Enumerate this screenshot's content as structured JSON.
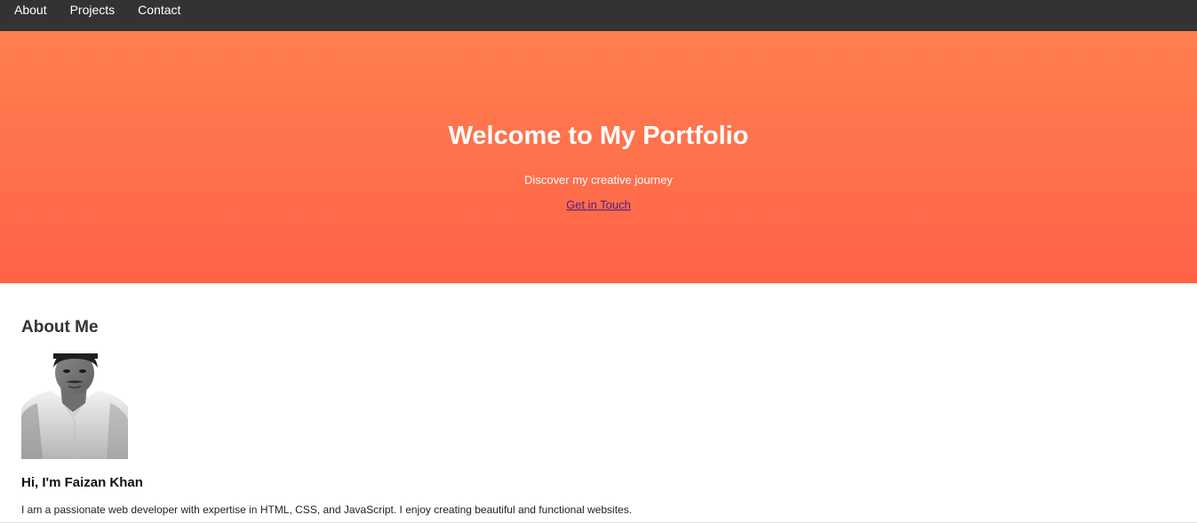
{
  "nav": {
    "items": [
      {
        "label": "About"
      },
      {
        "label": "Projects"
      },
      {
        "label": "Contact"
      }
    ]
  },
  "hero": {
    "title": "Welcome to My Portfolio",
    "subtitle": "Discover my creative journey",
    "cta_label": "Get in Touch"
  },
  "about": {
    "heading": "About Me",
    "photo_icon": "profile-photo",
    "name_heading": "Hi, I'm Faizan Khan",
    "description": "I am a passionate web developer with expertise in HTML, CSS, and JavaScript. I enjoy creating beautiful and functional websites."
  },
  "colors": {
    "navbar": "#333333",
    "hero_gradient_top": "#ff7f50",
    "hero_gradient_bottom": "#ff6347",
    "link_visited": "#551a8b"
  }
}
